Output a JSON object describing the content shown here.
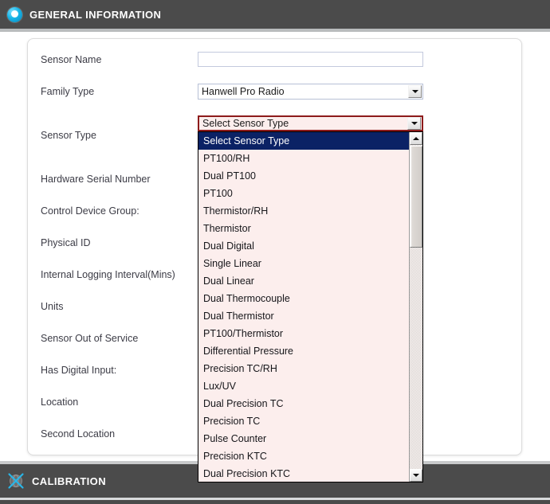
{
  "sections": {
    "general": {
      "title": "GENERAL INFORMATION",
      "icon": "record-circle-icon"
    },
    "calibration": {
      "title": "CALIBRATION",
      "icon": "calibration-crosshair-icon"
    }
  },
  "form": {
    "rows": [
      {
        "label": "Sensor Name"
      },
      {
        "label": "Family Type"
      },
      {
        "label": "Sensor Type"
      },
      {
        "label": "Hardware Serial Number"
      },
      {
        "label": "Control Device Group:"
      },
      {
        "label": "Physical ID"
      },
      {
        "label": "Internal Logging Interval(Mins)"
      },
      {
        "label": "Units"
      },
      {
        "label": "Sensor Out of Service"
      },
      {
        "label": "Has Digital Input:"
      },
      {
        "label": "Location"
      },
      {
        "label": "Second Location"
      }
    ],
    "sensor_name": {
      "value": "",
      "placeholder": ""
    },
    "family_type": {
      "value": "Hanwell Pro Radio"
    },
    "sensor_type": {
      "value": "Select Sensor Type"
    }
  },
  "dropdown": {
    "selected": "Select Sensor Type",
    "options": [
      "Select Sensor Type",
      "PT100/RH",
      "Dual PT100",
      "PT100",
      "Thermistor/RH",
      "Thermistor",
      "Dual Digital",
      "Single Linear",
      "Dual Linear",
      "Dual Thermocouple",
      "Dual Thermistor",
      "PT100/Thermistor",
      "Differential Pressure",
      "Precision TC/RH",
      "Lux/UV",
      "Dual Precision TC",
      "Precision TC",
      "Pulse Counter",
      "Precision KTC",
      "Dual Precision KTC"
    ]
  },
  "colors": {
    "section_bar": "#4b4b4b",
    "accent_cyan": "#18b6e8",
    "dropdown_background": "#fceeed",
    "selection_blue": "#0b2265",
    "error_border": "#8d1b1b"
  }
}
